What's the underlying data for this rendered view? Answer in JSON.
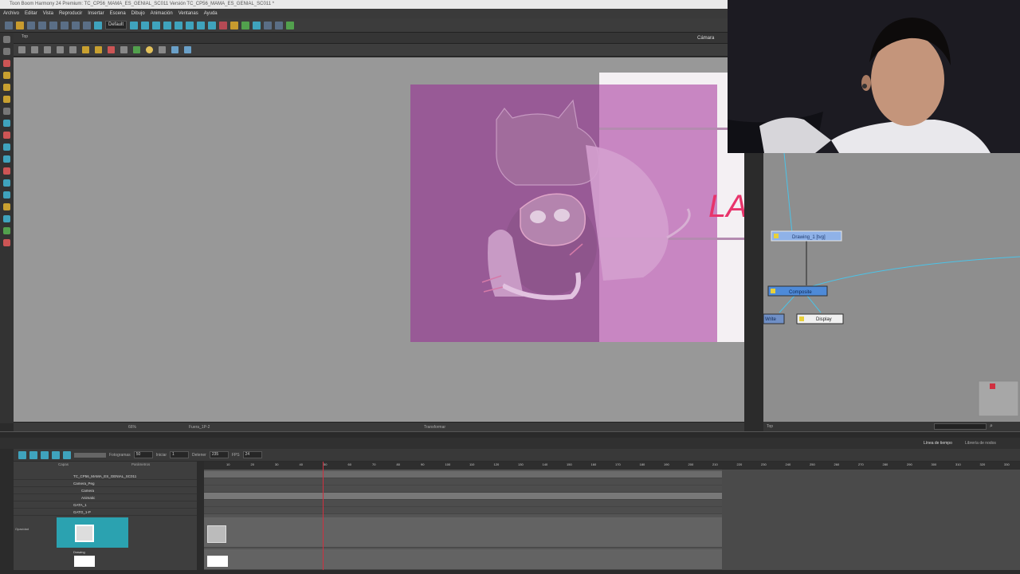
{
  "window": {
    "title": "Toon Boom Harmony 24 Premium: TC_CP56_MAMA_ES_GENIAL_SC011 Versión TC_CP56_MAMA_ES_GENIAL_SC011 *"
  },
  "menu": {
    "items": [
      "Archivo",
      "Editar",
      "Vista",
      "Reproducir",
      "Insertar",
      "Escena",
      "Dibujo",
      "Animación",
      "Ventanas",
      "Ayuda"
    ]
  },
  "toolbar": {
    "workspace_value": "Default"
  },
  "camera_view": {
    "tab_label": "Cámara",
    "view_label": "Top",
    "canvas_text": "LA",
    "status_left": "Fuera_1P-2",
    "status_center": "Transformar",
    "status_zoom": "66%"
  },
  "node_view": {
    "nodes": {
      "drawing": "Drawing_1 [tvg]",
      "composite": "Composite",
      "write": "Write",
      "display": "Display"
    },
    "status_label": "Top"
  },
  "timeline": {
    "tabs": [
      "Línea de tiempo",
      "Librería de nodos"
    ],
    "frames_label": "Fotogramas",
    "frames_value": "50",
    "start_label": "Iniciar",
    "start_value": "1",
    "stop_label": "Detener",
    "stop_value": "235",
    "fps_label": "FPS",
    "fps_value": "24",
    "ruler": [
      "10",
      "20",
      "30",
      "40",
      "50",
      "60",
      "70",
      "80",
      "90",
      "100",
      "110",
      "120",
      "130",
      "140",
      "150",
      "160",
      "170",
      "180",
      "190",
      "200",
      "210",
      "220",
      "230",
      "240",
      "250",
      "260",
      "270",
      "280",
      "290",
      "300",
      "310",
      "320",
      "330"
    ],
    "column_headers": [
      "Capas",
      "Parámetros"
    ],
    "layers": [
      {
        "name": "TC_CP56_MAMA_ES_GENIAL_SC011"
      },
      {
        "name": "Camera_Peg"
      },
      {
        "name": "Camera"
      },
      {
        "name": "Animatic"
      },
      {
        "name": "GATA_1"
      },
      {
        "name": "GATO_1-P"
      }
    ],
    "opacity_label": "Opacidad",
    "drawing_label": "Drawing"
  }
}
